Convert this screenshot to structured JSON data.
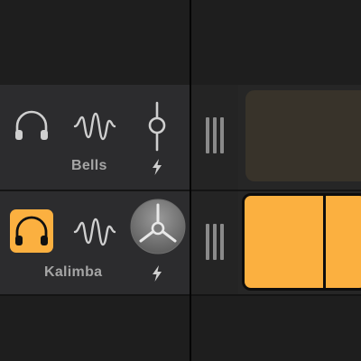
{
  "tracks": [
    {
      "name": "Bells",
      "headphones_active": false,
      "control_type": "slider",
      "region_color": "#38332a"
    },
    {
      "name": "Kalimba",
      "headphones_active": true,
      "control_type": "knob",
      "region_color": "#fbb040"
    }
  ],
  "colors": {
    "accent": "#fbb040",
    "header_background": "#2c2c2e",
    "icon": "#cfcfcf",
    "label": "#a5a5a5"
  },
  "icons": {
    "headphones": "headphones-icon",
    "waveform": "waveform-icon",
    "slider": "volume-slider-icon",
    "knob": "volume-knob",
    "bolt": "lightning-bolt-icon",
    "grip": "drag-handle-icon"
  }
}
